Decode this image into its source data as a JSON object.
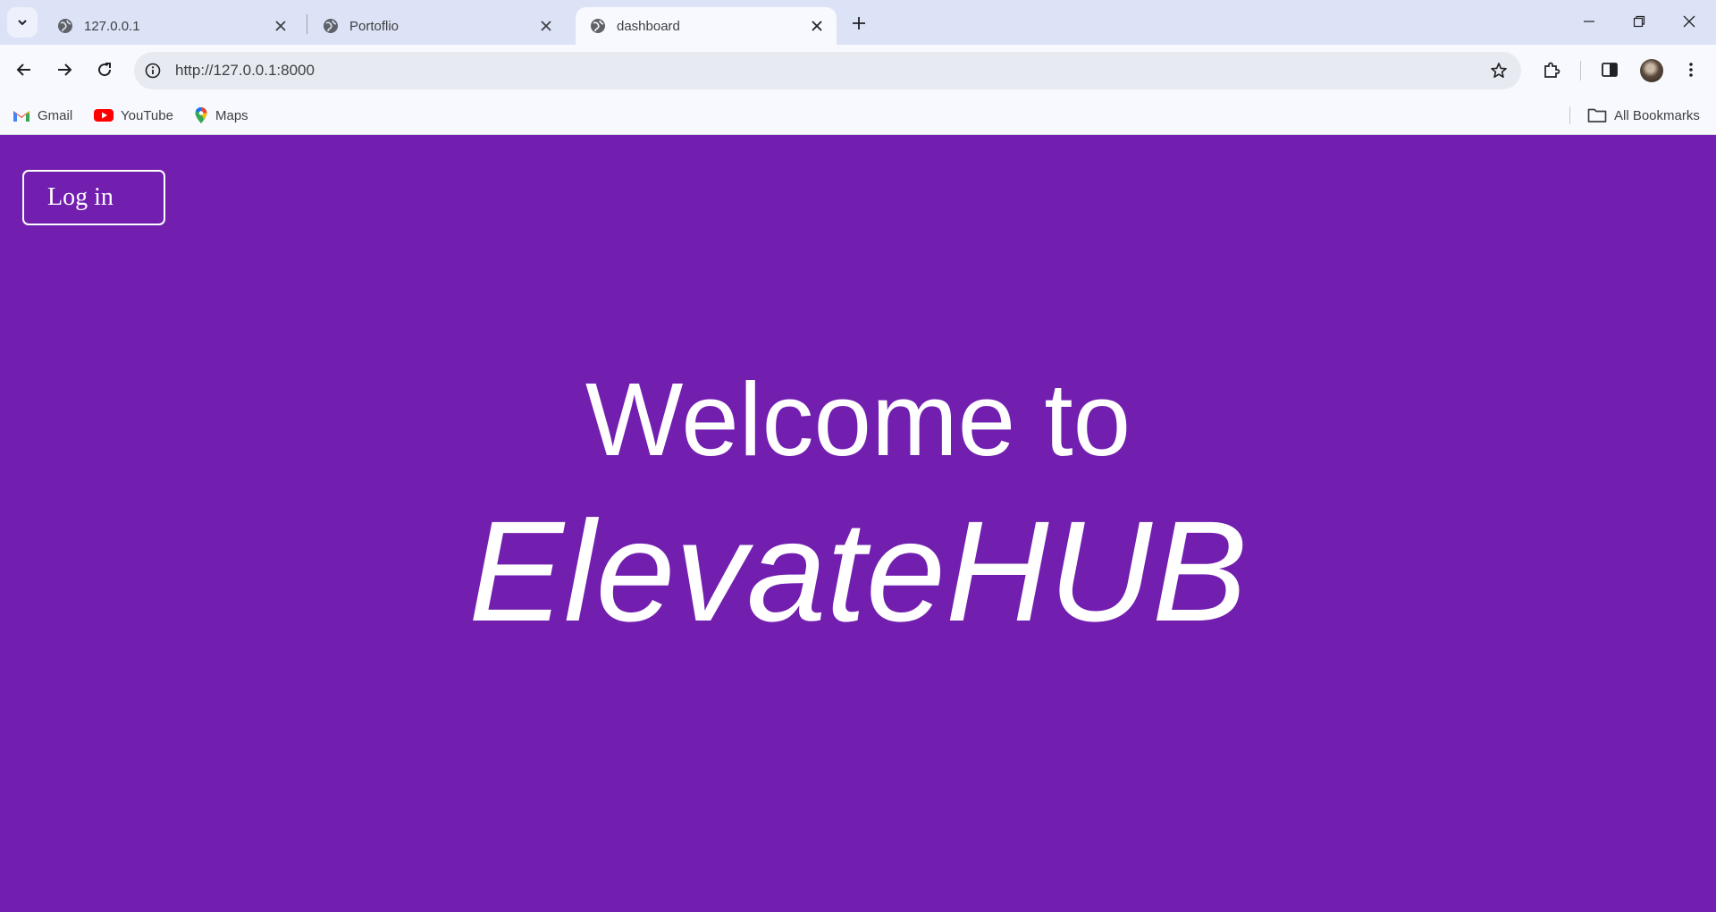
{
  "browser": {
    "tabs": [
      {
        "title": "127.0.0.1",
        "icon": "globe-icon",
        "active": false
      },
      {
        "title": "Portoflio",
        "icon": "globe-icon",
        "active": false
      },
      {
        "title": "dashboard",
        "icon": "globe-icon",
        "active": true
      }
    ],
    "address": {
      "url": "http://127.0.0.1:8000"
    },
    "bookmarks": [
      {
        "label": "Gmail",
        "icon": "gmail-icon"
      },
      {
        "label": "YouTube",
        "icon": "youtube-icon"
      },
      {
        "label": "Maps",
        "icon": "maps-icon"
      }
    ],
    "all_bookmarks_label": "All Bookmarks"
  },
  "page": {
    "login_label": "Log in",
    "welcome_text": "Welcome to",
    "brand_text": "ElevateHUB",
    "background_color": "#721fb0"
  }
}
